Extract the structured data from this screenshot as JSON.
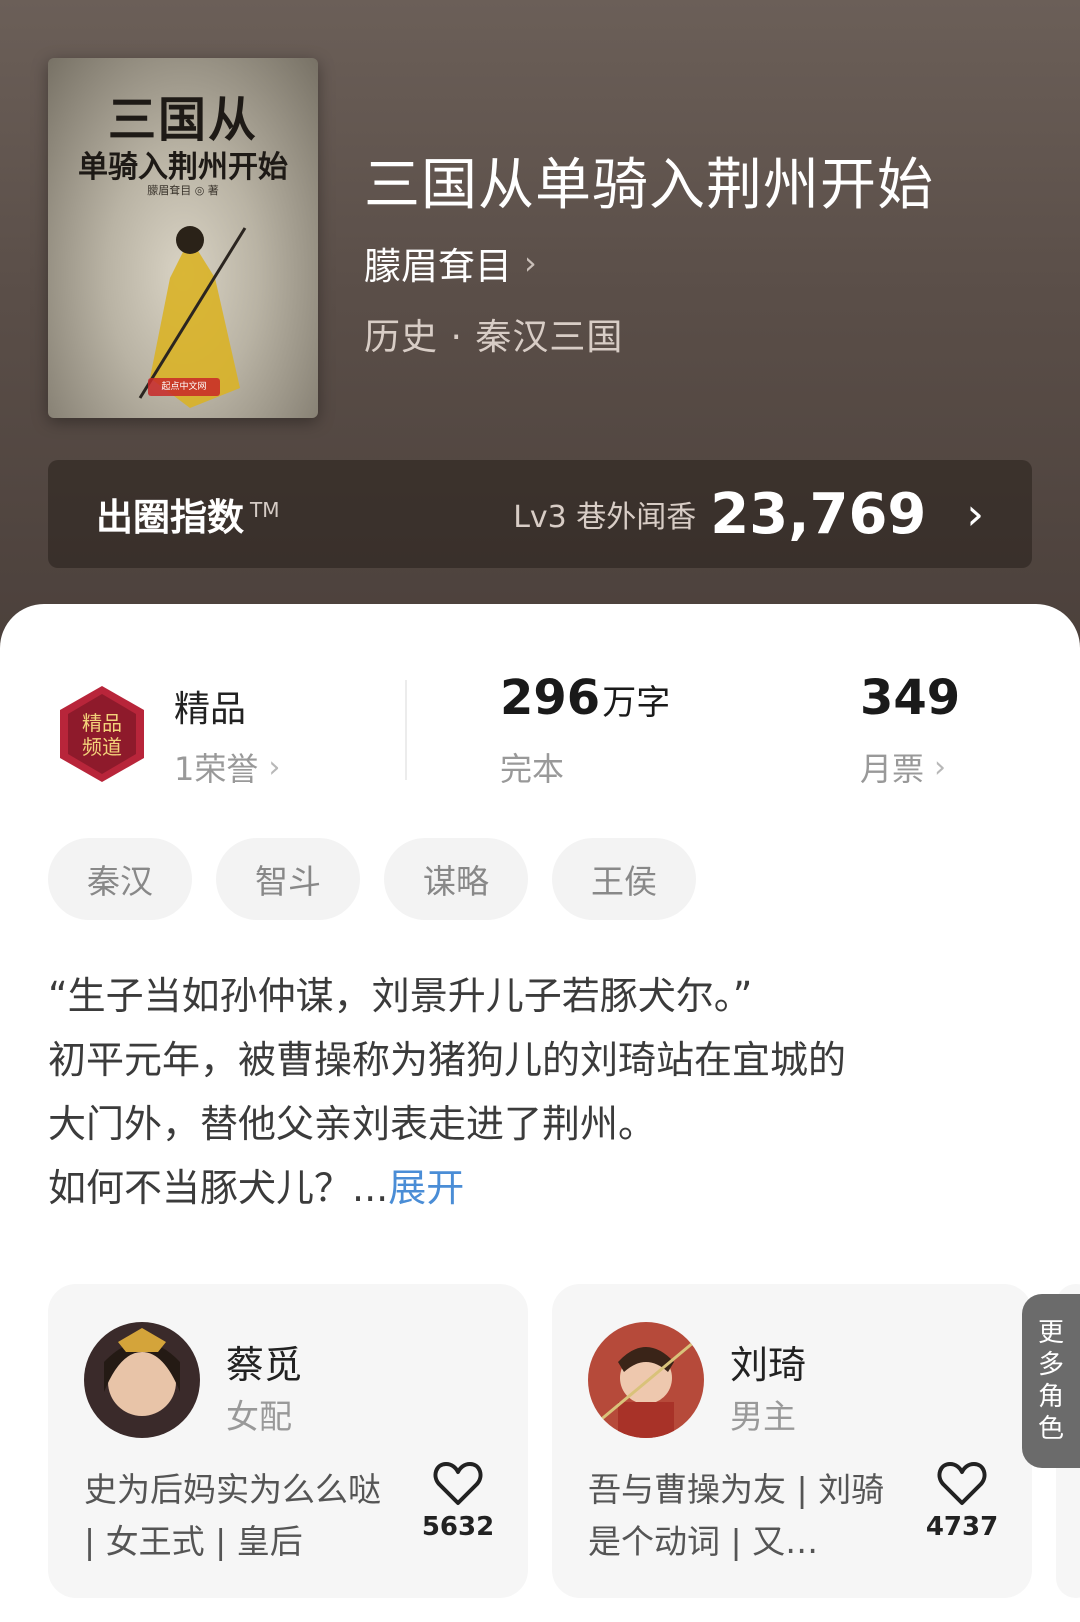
{
  "book": {
    "cover_title_line1": "三国从",
    "cover_title_line2": "单骑入荆州开始",
    "cover_author": "朦眉耷目 ◎ 著",
    "cover_publisher": "起点中文网",
    "title": "三国从单骑入荆州开始",
    "author": "朦眉耷目",
    "genre": "历史 · 秦汉三国"
  },
  "index": {
    "label": "出圈指数",
    "tm": "TM",
    "level": "Lv3 巷外闻香",
    "score": "23,769"
  },
  "stats": {
    "badge_label": "精品",
    "honor": "1荣誉",
    "words_value": "296",
    "words_unit": "万字",
    "status": "完本",
    "tickets_value": "349",
    "tickets_label": "月票"
  },
  "tags": [
    "秦汉",
    "智斗",
    "谋略",
    "王侯"
  ],
  "description": {
    "lines": [
      "“生子当如孙仲谋，刘景升儿子若豚犬尔。”",
      "初平元年，被曹操称为猪狗儿的刘琦站在宜城的",
      "大门外，替他父亲刘表走进了荆州。",
      "如何不当豚犬儿？..."
    ],
    "expand": "展开"
  },
  "characters": [
    {
      "name": "蔡觅",
      "role": "女配",
      "desc": "史为后妈实为么么哒 | 女王式 | 皇后",
      "likes": "5632"
    },
    {
      "name": "刘琦",
      "role": "男主",
      "desc": "吾与曹操为友 | 刘骑是个动词 | 又…",
      "likes": "4737"
    }
  ],
  "more_roles": "更多角色",
  "colors": {
    "hero_bg": "#5a4e48",
    "link_blue": "#4a8dd6",
    "tag_bg": "#f3f3f3",
    "card_bg": "#f6f6f6"
  }
}
